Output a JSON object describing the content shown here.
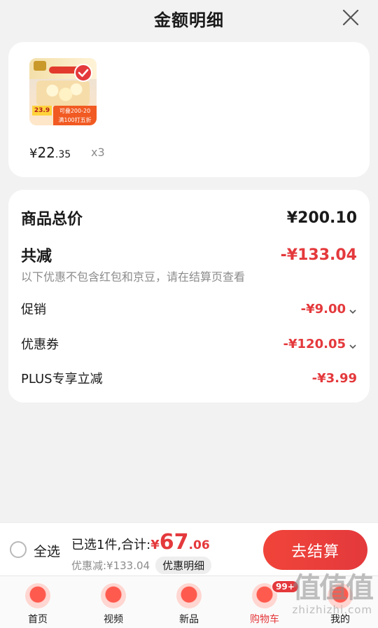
{
  "header": {
    "title": "金额明细"
  },
  "product": {
    "price_currency": "¥",
    "price_integer": "22",
    "price_decimal": ".35",
    "quantity": "x3",
    "thumb_price": "23.9",
    "thumb_promo_line1": "可叠200-20",
    "thumb_promo_line2": "满100打五折"
  },
  "breakdown": {
    "total_label": "商品总价",
    "total_value": "¥200.10",
    "discount_label": "共减",
    "discount_value": "-¥133.04",
    "note": "以下优惠不包含红包和京豆，请在结算页查看",
    "items": [
      {
        "label": "促销",
        "value": "-¥9.00"
      },
      {
        "label": "优惠券",
        "value": "-¥120.05"
      },
      {
        "label": "PLUS专享立减",
        "value": "-¥3.99"
      }
    ]
  },
  "checkout": {
    "select_all": "全选",
    "summary_text": "已选1件,合计:",
    "sum_currency": "¥",
    "sum_integer": "67",
    "sum_decimal": ".06",
    "discount_text": "优惠减:¥133.04",
    "detail_tag": "优惠明细",
    "button": "去结算"
  },
  "nav": {
    "items": [
      {
        "label": "首页"
      },
      {
        "label": "视频"
      },
      {
        "label": "新品"
      },
      {
        "label": "购物车"
      },
      {
        "label": "我的"
      }
    ],
    "cart_badge": "99+"
  },
  "watermark": {
    "big": "值值值",
    "small": "zhizhizhi.com"
  },
  "colors": {
    "accent": "#e4393c",
    "background": "#f2f2f2",
    "card": "#ffffff"
  }
}
